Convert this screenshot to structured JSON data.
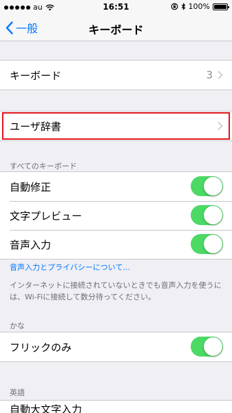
{
  "status_bar": {
    "carrier": "au",
    "time": "16:51",
    "battery": "100%",
    "icons": [
      "signal-dots-icon",
      "wifi-icon",
      "orientation-lock-icon",
      "bluetooth-icon",
      "battery-icon"
    ]
  },
  "nav": {
    "back_label": "一般",
    "title": "キーボード"
  },
  "keyboards_row": {
    "label": "キーボード",
    "value": "3"
  },
  "user_dictionary_row": {
    "label": "ユーザ辞書"
  },
  "all_keyboards_section": {
    "header": "すべてのキーボード",
    "rows": [
      {
        "label": "自動修正",
        "on": true
      },
      {
        "label": "文字プレビュー",
        "on": true
      },
      {
        "label": "音声入力",
        "on": true
      }
    ],
    "link": "音声入力とプライバシーについて...",
    "footer": "インターネットに接続されていないときでも音声入力を使うには、Wi-Fiに接続して数分待ってください。"
  },
  "kana_section": {
    "header": "かな",
    "rows": [
      {
        "label": "フリックのみ",
        "on": true
      }
    ]
  },
  "english_section": {
    "header": "英語",
    "rows": [
      {
        "label": "自動大文字入力"
      }
    ]
  },
  "colors": {
    "accent": "#007aff",
    "toggle_on": "#4cd964",
    "highlight": "#e0161d"
  }
}
